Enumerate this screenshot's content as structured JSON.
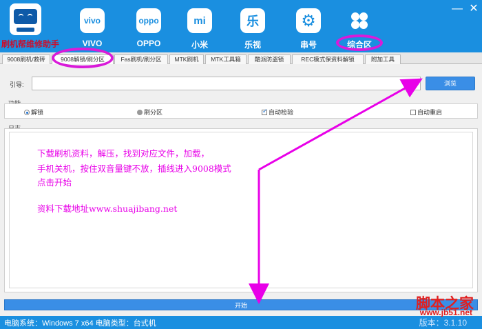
{
  "header": {
    "app_name": "刷机帮维修助手",
    "brands": [
      {
        "icon": "vivo-logo-icon",
        "icon_text": "vivo",
        "label": "VIVO"
      },
      {
        "icon": "oppo-logo-icon",
        "icon_text": "oppo",
        "label": "OPPO"
      },
      {
        "icon": "xiaomi-logo-icon",
        "icon_text": "mi",
        "label": "小米"
      },
      {
        "icon": "letv-logo-icon",
        "icon_text": "乐",
        "label": "乐视"
      },
      {
        "icon": "gear-serial-icon",
        "icon_text": "⚙",
        "label": "串号"
      },
      {
        "icon": "grid-menu-icon",
        "icon_text": "",
        "label": "综合区"
      }
    ]
  },
  "tabs": [
    {
      "label": "9008刷机/救砖"
    },
    {
      "label": "9008解锁/刷分区"
    },
    {
      "label": "Fas刷机/刷分区"
    },
    {
      "label": "MTK刷机"
    },
    {
      "label": "MTK工具箱"
    },
    {
      "label": "酷派防盗锁"
    },
    {
      "label": "REC模式保资料解锁"
    },
    {
      "label": "附加工具"
    }
  ],
  "guide": {
    "label": "引导:",
    "value": "",
    "browse_label": "浏览"
  },
  "function_group": {
    "title": "功能",
    "options": [
      {
        "label": "解锁",
        "type": "radio",
        "checked": true
      },
      {
        "label": "刷分区",
        "type": "radio",
        "checked": false
      },
      {
        "label": "自动检验",
        "type": "checkbox",
        "checked": true
      },
      {
        "label": "自动重启",
        "type": "checkbox",
        "checked": false
      }
    ]
  },
  "log": {
    "title": "日志",
    "lines": [
      "下载刷机资料，解压，找到对应文件，加载，",
      "手机关机，按住双音量键不放，插线进入9008模式",
      "点击开始",
      "",
      "资料下载地址www.shuajibang.net"
    ]
  },
  "start_label": "开始",
  "status": {
    "text": "电脑系统：Windows 7 x64 电脑类型：台式机",
    "version": "版本：3.1.10"
  },
  "watermark": {
    "title": "脚本之家",
    "url": "www.jb51.net"
  },
  "colors": {
    "accent": "#1a8fe0",
    "annotation": "#e800e8",
    "brand_text": "#c8102e"
  }
}
